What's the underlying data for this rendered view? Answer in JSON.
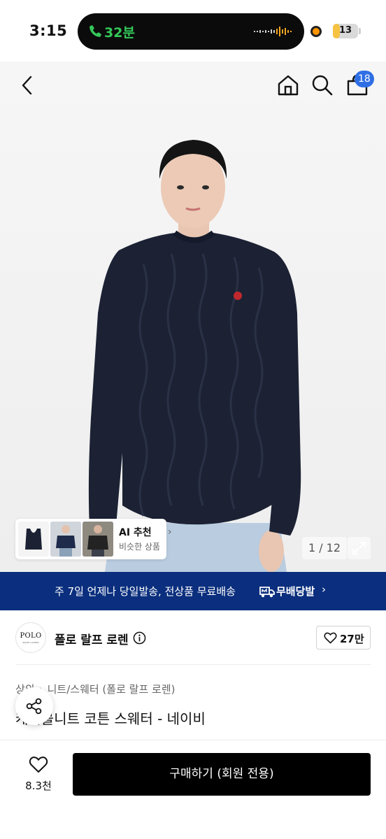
{
  "status_bar": {
    "time": "3:15",
    "call_label": "32분",
    "battery_level": "13",
    "battery_percent": 0.13
  },
  "header": {
    "cart_count": "18",
    "icons": [
      "back-icon",
      "home-icon",
      "search-icon",
      "bag-icon"
    ]
  },
  "gallery": {
    "counter": "1 / 12",
    "ai_title": "AI 추천",
    "ai_subtitle": "비슷한 상품"
  },
  "promo": {
    "text": "주 7일 언제나 당일발송, 전상품 무료배송",
    "brand": "무배당발",
    "color": "#0b2f7e"
  },
  "brand": {
    "logo_text": "POLO",
    "logo_subtext": "RALPH LAUREN",
    "name": "폴로 랄프 로렌",
    "like_count": "27만"
  },
  "product": {
    "breadcrumb": [
      "상의",
      "니트/스웨터 (폴로 랄프 로렌)"
    ],
    "title": "케이블니트 코튼 스웨터 - 네이비"
  },
  "bottom_bar": {
    "wish_count": "8.3천",
    "buy_label": "구매하기 (회원 전용)"
  }
}
